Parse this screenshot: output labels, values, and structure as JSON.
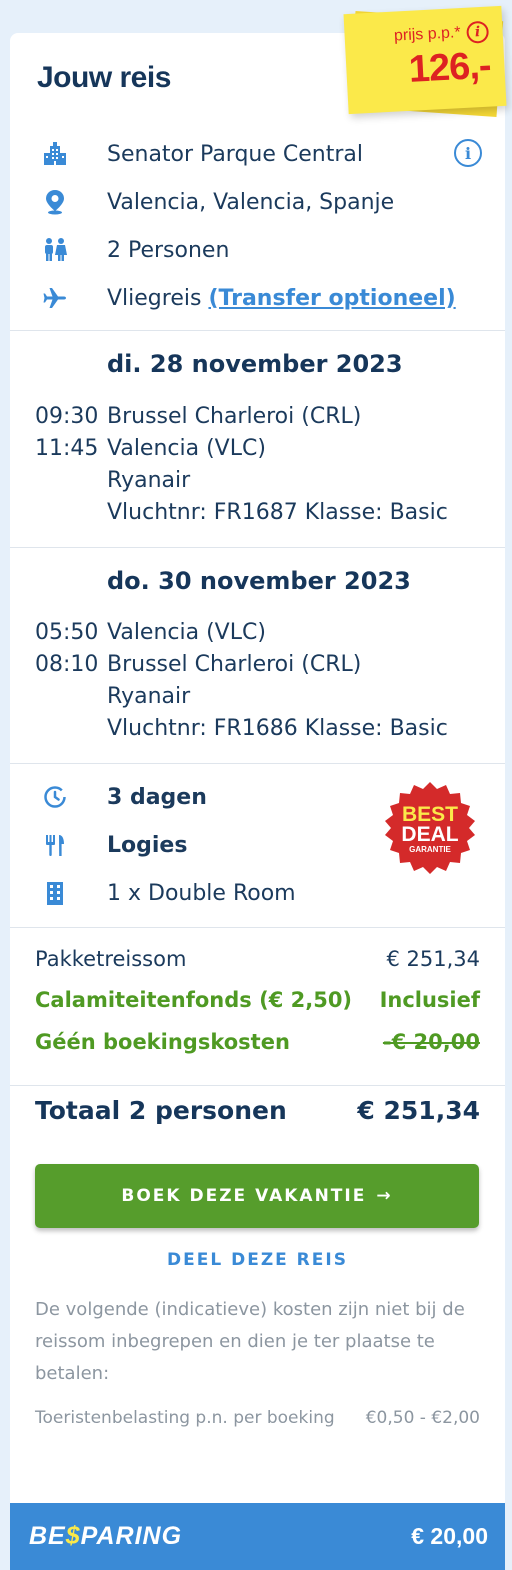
{
  "header": {
    "title": "Jouw reis",
    "price_label": "prijs p.p.*",
    "price_value": "126,-"
  },
  "summary": {
    "hotel": "Senator Parque Central",
    "location": "Valencia, Valencia, Spanje",
    "persons": "2 Personen",
    "travel_type": "Vliegreis",
    "transfer_link": "(Transfer optioneel)"
  },
  "flights": [
    {
      "date": "di. 28 november 2023",
      "dep_time": "09:30",
      "arr_time": "11:45",
      "from": "Brussel Charleroi (CRL)",
      "to": "Valencia (VLC)",
      "airline": "Ryanair",
      "details": "Vluchtnr: FR1687 Klasse: Basic"
    },
    {
      "date": "do. 30 november 2023",
      "dep_time": "05:50",
      "arr_time": "08:10",
      "from": "Valencia (VLC)",
      "to": "Brussel Charleroi (CRL)",
      "airline": "Ryanair",
      "details": "Vluchtnr: FR1686 Klasse: Basic"
    }
  ],
  "stay": {
    "duration": "3 dagen",
    "board": "Logies",
    "room": "1 x Double Room",
    "badge_line1": "BEST",
    "badge_line2": "DEAL",
    "badge_line3": "GARANTIE"
  },
  "pricing": {
    "package_label": "Pakketreissom",
    "package_value": "€ 251,34",
    "calamity_label": "Calamiteitenfonds (€ 2,50)",
    "calamity_value": "Inclusief",
    "fee_label": "Géén boekingskosten",
    "fee_value": "-€ 20,00",
    "total_label": "Totaal 2 personen",
    "total_value": "€ 251,34"
  },
  "actions": {
    "book_label": "BOEK DEZE VAKANTIE",
    "book_arrow": "→",
    "share_label": "DEEL DEZE REIS"
  },
  "notes": {
    "extra_costs": "De volgende (indicatieve) kosten zijn niet bij de reissom inbegrepen en dien je ter plaatse te betalen:",
    "tax_label": "Toeristenbelasting p.n. per boeking",
    "tax_value": "€0,50 - €2,00"
  },
  "savings": {
    "brand_pre": "BE",
    "brand_dollar": "$",
    "brand_post": "PARING",
    "amount": "€ 20,00"
  },
  "colors": {
    "accent_blue": "#3a8ad6",
    "navy": "#16365a",
    "green": "#569d2c",
    "price_red": "#dd2222",
    "sticky_yellow": "#fbe94a"
  }
}
